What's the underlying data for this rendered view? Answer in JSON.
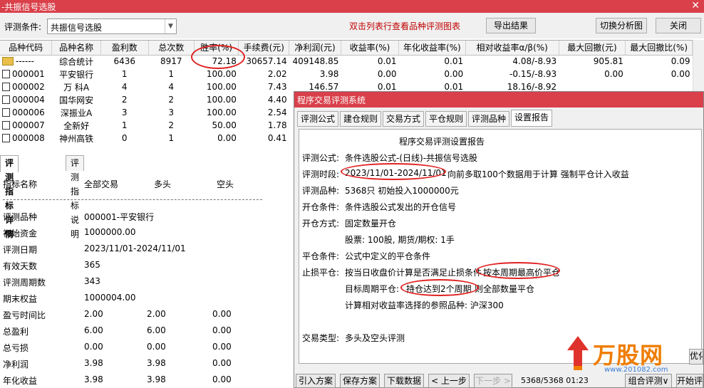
{
  "window": {
    "title": "-共振信号选股",
    "close": "✕"
  },
  "toolbar": {
    "cond_label": "评测条件:",
    "cond_value": "共振信号选股",
    "hint": "双击列表行查看品种评测图表",
    "export_label": "导出结果",
    "switch_label": "切换分析图",
    "close_label": "关闭"
  },
  "table": {
    "columns": [
      "品种代码",
      "品种名称",
      "盈利数",
      "总次数",
      "胜率(%)",
      "手续费(元)",
      "净利润(元)",
      "收益率(%)",
      "年化收益率(%)",
      "相对收益率α/β(%)",
      "最大回撤(元)",
      "最大回撤比(%)"
    ],
    "summary": {
      "code": "------",
      "name": "综合统计",
      "cells": [
        "6436",
        "8917",
        "72.18",
        "30657.14",
        "409148.85",
        "0.01",
        "0.01",
        "4.08/-8.93",
        "905.81",
        "0.09"
      ]
    },
    "rows": [
      {
        "code": "000001",
        "name": "平安银行",
        "cells": [
          "1",
          "1",
          "100.00",
          "2.02",
          "3.98",
          "0.00",
          "0.00",
          "-0.15/-8.93",
          "0.00",
          "0.00"
        ]
      },
      {
        "code": "000002",
        "name": "万 科A",
        "cells": [
          "4",
          "4",
          "100.00",
          "7.43",
          "146.57",
          "0.01",
          "0.01",
          "18.16/-8.92",
          "",
          ""
        ]
      },
      {
        "code": "000004",
        "name": "国华网安",
        "cells": [
          "2",
          "2",
          "100.00",
          "4.40",
          "",
          "",
          "",
          "",
          "",
          ""
        ]
      },
      {
        "code": "000006",
        "name": "深振业A",
        "cells": [
          "3",
          "3",
          "100.00",
          "2.54",
          "",
          "",
          "",
          "",
          "",
          ""
        ]
      },
      {
        "code": "000007",
        "name": "全新好",
        "cells": [
          "1",
          "2",
          "50.00",
          "1.78",
          "",
          "",
          "",
          "",
          "",
          ""
        ]
      },
      {
        "code": "000008",
        "name": "神州高铁",
        "cells": [
          "0",
          "1",
          "0.00",
          "0.41",
          "",
          "",
          "",
          "",
          "",
          ""
        ]
      }
    ]
  },
  "left": {
    "tabs": [
      "评测指标详情",
      "评测指标说明"
    ],
    "header": [
      "指标名称",
      "全部交易",
      "多头",
      "空头"
    ],
    "rows": [
      {
        "k": "评测品种",
        "a": "000001-平安银行",
        "b": "",
        "c": ""
      },
      {
        "k": "初始资金",
        "a": "1000000.00",
        "b": "",
        "c": ""
      },
      {
        "k": "评测日期",
        "a": "2023/11/01-2024/11/01",
        "b": "",
        "c": ""
      },
      {
        "k": "有效天数",
        "a": "365",
        "b": "",
        "c": ""
      },
      {
        "k": "评测周期数",
        "a": "343",
        "b": "",
        "c": ""
      },
      {
        "k": "期末权益",
        "a": "1000004.00",
        "b": "",
        "c": ""
      },
      {
        "k": "盈亏时间比",
        "a": "2.00",
        "b": "2.00",
        "c": "0.00"
      },
      {
        "k": "总盈利",
        "a": "6.00",
        "b": "6.00",
        "c": "0.00"
      },
      {
        "k": "总亏损",
        "a": "0.00",
        "b": "0.00",
        "c": "0.00"
      },
      {
        "k": "净利润",
        "a": "3.98",
        "b": "3.98",
        "c": "0.00"
      },
      {
        "k": "年化收益",
        "a": "3.98",
        "b": "3.98",
        "c": "0.00"
      }
    ]
  },
  "dialog": {
    "title": "程序交易评测系统",
    "tabs": [
      "评测公式",
      "建仓规则",
      "交易方式",
      "平仓规则",
      "评测品种",
      "设置报告"
    ],
    "report": {
      "heading": "程序交易评测设置报告",
      "formula_k": "评测公式:",
      "formula_v": "条件选股公式-(日线)-共振信号选股",
      "period_k": "评测时段:",
      "period_v": "2023/11/01-2024/11/01",
      "period_tail": "向前多取100个数据用于计算 强制平仓计入收益",
      "variety_k": "评测品种:",
      "variety_v": "5368只 初始投入1000000元",
      "open_k": "开仓条件:",
      "open_v": "条件选股公式发出的开仓信号",
      "mode_k": "开仓方式:",
      "mode_v": "固定数量开仓",
      "mode_sub": "股票: 100股, 期货/期权: 1手",
      "close_k": "平仓条件:",
      "close_v": "公式中定义的平仓条件",
      "stop_k": "止损平仓:",
      "stop_v": "按当日收盘价计算是否满足止损条件",
      "stop_v2": "按本周期最高价平仓",
      "target_k": "目标周期平仓:",
      "target_v": "持仓达到2个周期",
      "target_v2": "则全部数量平仓",
      "bench": "计算相对收益率选择的参照品种: 沪深300",
      "type_k": "交易类型:",
      "type_v": "多头及空头评测"
    },
    "buttons": [
      "引入方案",
      "保存方案",
      "下载数据",
      "< 上一步",
      "下一步 >"
    ],
    "status": "5368/5368 01:23",
    "right_buttons": [
      "组合评测∨",
      "开始评"
    ],
    "side_btn": "优化"
  },
  "watermark": {
    "text": "万股网",
    "logo": "万股网",
    "url": "www.201082.com"
  },
  "colors": {
    "title": "#d9404a",
    "accent": "#c00000",
    "oval": "#e02020"
  }
}
